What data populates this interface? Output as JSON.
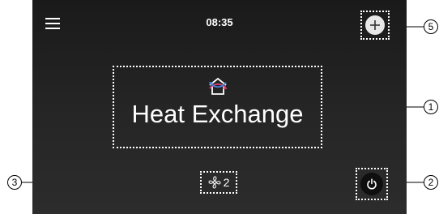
{
  "status_bar": {
    "time": "08:35"
  },
  "main": {
    "mode_label": "Heat Exchange",
    "fan_level": "2"
  },
  "icons": {
    "menu": "hamburger-menu-icon",
    "add": "plus-icon",
    "mode": "heat-exchange-house-icon",
    "fan": "fan-icon",
    "power": "power-icon"
  },
  "callouts": {
    "labels": [
      "1",
      "2",
      "3",
      "5"
    ]
  }
}
